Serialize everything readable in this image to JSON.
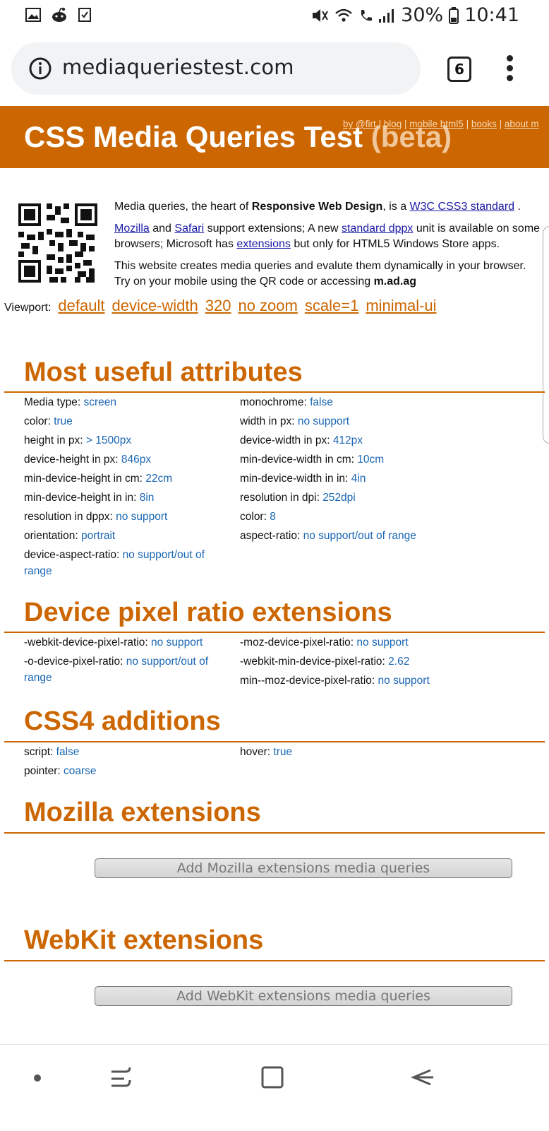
{
  "status": {
    "battery": "30%",
    "time": "10:41"
  },
  "browser": {
    "url": "mediaqueriestest.com",
    "tab_count": "6"
  },
  "banner": {
    "title": "CSS Media Queries Test",
    "beta": "(beta)",
    "links": [
      "by @firt",
      "blog",
      "mobile html5",
      "books",
      "about m"
    ]
  },
  "intro": {
    "p1_a": "Media queries, the heart of ",
    "p1_bold": "Responsive Web Design",
    "p1_b": ", is a ",
    "p1_link": "W3C CSS3 standard",
    "p1_c": " .",
    "p2_link1": "Mozilla",
    "p2_a": " and ",
    "p2_link2": "Safari",
    "p2_b": " support extensions; A new ",
    "p2_link3": "standard dppx",
    "p2_c": " unit is available on some browsers; Microsoft has ",
    "p2_link4": "extensions",
    "p2_d": " but only for HTML5 Windows Store apps.",
    "p3_a": "This website creates media queries and evalute them dynamically in your browser. Try on your mobile using the QR code or accessing ",
    "p3_bold": "m.ad.ag"
  },
  "viewport": {
    "label": "Viewport:",
    "options": [
      "default",
      "device-width",
      "320",
      "no zoom",
      "scale=1",
      "minimal-ui"
    ]
  },
  "sections": {
    "useful": {
      "title": "Most useful attributes",
      "left": [
        {
          "k": "Media type: ",
          "v": "screen"
        },
        {
          "k": "color: ",
          "v": "true"
        },
        {
          "k": "height in px: ",
          "v": "> 1500px"
        },
        {
          "k": "device-height in px: ",
          "v": "846px"
        },
        {
          "k": "min-device-height in cm: ",
          "v": "22cm"
        },
        {
          "k": "min-device-height in in: ",
          "v": "8in"
        },
        {
          "k": "resolution in dppx: ",
          "v": "no support"
        },
        {
          "k": "orientation: ",
          "v": "portrait"
        },
        {
          "k": "device-aspect-ratio: ",
          "v": "no support/out of range"
        }
      ],
      "right": [
        {
          "k": "monochrome: ",
          "v": "false"
        },
        {
          "k": "width in px: ",
          "v": "no support"
        },
        {
          "k": "device-width in px: ",
          "v": "412px"
        },
        {
          "k": "min-device-width in cm: ",
          "v": "10cm"
        },
        {
          "k": "min-device-width in in: ",
          "v": "4in"
        },
        {
          "k": "resolution in dpi: ",
          "v": "252dpi"
        },
        {
          "k": "color: ",
          "v": "8"
        },
        {
          "k": "aspect-ratio: ",
          "v": "no support/out of range"
        }
      ]
    },
    "dpr": {
      "title": "Device pixel ratio extensions",
      "left": [
        {
          "k": "-webkit-device-pixel-ratio: ",
          "v": "no support"
        },
        {
          "k": "-o-device-pixel-ratio: ",
          "v": "no support/out of range"
        }
      ],
      "right": [
        {
          "k": "-moz-device-pixel-ratio: ",
          "v": "no support"
        },
        {
          "k": "-webkit-min-device-pixel-ratio: ",
          "v": "2.62"
        },
        {
          "k": "min--moz-device-pixel-ratio: ",
          "v": "no support"
        }
      ]
    },
    "css4": {
      "title": "CSS4 additions",
      "left": [
        {
          "k": "script: ",
          "v": "false"
        },
        {
          "k": "pointer: ",
          "v": "coarse"
        }
      ],
      "right": [
        {
          "k": "hover: ",
          "v": "true"
        }
      ]
    },
    "mozilla": {
      "title": "Mozilla extensions",
      "button": "Add Mozilla extensions media queries"
    },
    "webkit": {
      "title": "WebKit extensions",
      "button": "Add WebKit extensions media queries"
    }
  },
  "colors": {
    "accent": "#cc6600",
    "value": "#1a66b3",
    "link": "#1a1aa6"
  }
}
